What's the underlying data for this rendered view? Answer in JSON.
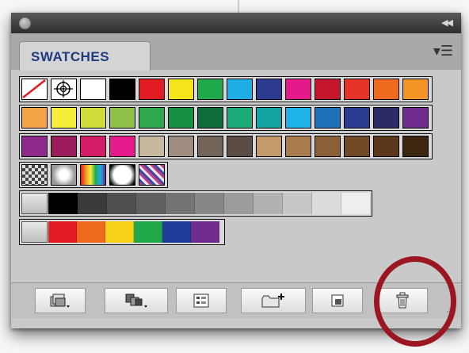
{
  "panel": {
    "tab_label": "SWATCHES",
    "controls": {
      "close_icon": "close-circle",
      "collapse_icon": "double-left-arrow"
    },
    "menu_icon": "panel-menu-icon"
  },
  "swatches": {
    "row1": [
      "none",
      "registration",
      "#ffffff",
      "#000000",
      "#e21b23",
      "#f3e51a",
      "#20a84b",
      "#1eaee5",
      "#2c3a90",
      "#e6198b",
      "#c4172e",
      "#e73327",
      "#ee6a1f",
      "#f39526"
    ],
    "row2": [
      "#f4a347",
      "#f6ed3a",
      "#d0dc3a",
      "#8fc04a",
      "#2ea84b",
      "#159043",
      "#0d6b3c",
      "#1aab79",
      "#13a4a1",
      "#1fb2e8",
      "#1f72b7",
      "#2a3b90",
      "#2a2b67",
      "#6f2c8d"
    ],
    "row3": [
      "#8e2a8c",
      "#9c1b5d",
      "#d51c66",
      "#e61b8b",
      "#c7b8a0",
      "#9f8c80",
      "#736459",
      "#5b4d45",
      "#c59a6a",
      "#a97c4e",
      "#8b6038",
      "#724a28",
      "#5b3819",
      "#3d2610"
    ],
    "row4_patterns": [
      "checker-pattern",
      "soft-dots-pattern",
      "rainbow-gradient",
      "radial-gradient",
      "paisley-pattern"
    ],
    "gray_ramp": [
      "#000000",
      "#3a3a3a",
      "#4f4f4f",
      "#606060",
      "#747474",
      "#878787",
      "#9c9c9c",
      "#b1b1b1",
      "#c7c7c7",
      "#dcdcdc",
      "#eeeeee"
    ],
    "color_group": [
      "#e21b23",
      "#ee6a1f",
      "#f7d21a",
      "#20a84b",
      "#1f3d99",
      "#6f2c8d"
    ]
  },
  "bottom_buttons": [
    {
      "name": "swatch-libraries-menu",
      "icon": "swatch-libraries-icon"
    },
    {
      "name": "show-kinds-menu",
      "icon": "show-swatch-kinds-icon"
    },
    {
      "name": "swatch-options",
      "icon": "swatch-options-icon"
    },
    {
      "name": "new-color-group",
      "icon": "new-folder-icon"
    },
    {
      "name": "new-swatch",
      "icon": "new-swatch-icon"
    },
    {
      "name": "delete-swatch",
      "icon": "trash-icon"
    }
  ],
  "annotation": {
    "highlight_color": "#9c1622",
    "target": "delete-swatch"
  }
}
